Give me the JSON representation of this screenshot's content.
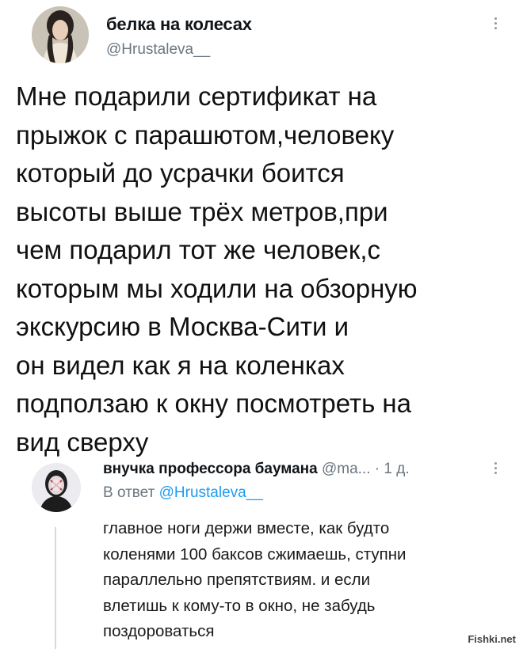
{
  "tweet": {
    "author_name": "белка на колесах",
    "author_handle": "@Hrustaleva__",
    "text": "Мне подарили сертификат на\nпрыжок с парашютом,человеку\nкоторый до усрачки боится\nвысоты выше трёх метров,при\nчем подарил тот же человек,с\nкоторым мы ходили на обзорную\nэкскурсию в Москва-Сити и\nон видел как я на коленках\nподползаю к окну посмотреть на\nвид сверху"
  },
  "reply": {
    "author_name": "внучка профессора баумана",
    "meta": "@ma... · 1 д.",
    "reply_to_label": "В ответ",
    "reply_to_handle": "@Hrustaleva__",
    "text": "главное ноги держи вместе, как будто\nколенями 100 баксов сжимаешь, ступни\nпараллельно препятствиям. и если\nвлетишь к кому-то в окно, не забудь\nпоздороваться"
  },
  "watermark": "Fishki.net",
  "icons": {
    "more_main": "more-vertical-icon",
    "more_reply": "more-vertical-icon"
  },
  "colors": {
    "link": "#1d9bf0",
    "secondary_text": "#6b7680"
  }
}
